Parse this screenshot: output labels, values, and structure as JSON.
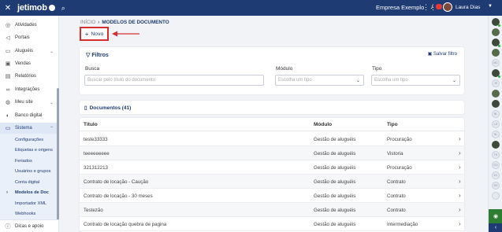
{
  "topbar": {
    "brand": "jetimob",
    "company": "Empresa Exemplo",
    "user": "Laura Dias"
  },
  "sidebar": {
    "items": [
      {
        "label": "Atividades",
        "icon": "check-circle-icon"
      },
      {
        "label": "Portais",
        "icon": "megaphone-icon"
      },
      {
        "label": "Aluguéis",
        "icon": "book-icon"
      },
      {
        "label": "Vendas",
        "icon": "cash-icon"
      },
      {
        "label": "Relatórios",
        "icon": "document-icon"
      },
      {
        "label": "Integrações",
        "icon": "link-icon"
      },
      {
        "label": "Meu site",
        "icon": "globe-icon"
      },
      {
        "label": "Banco digital",
        "icon": "piggy-bank-icon"
      },
      {
        "label": "Sistema",
        "icon": "monitor-icon"
      }
    ],
    "sub_items": [
      "Configurações",
      "Etiquetas e origens",
      "Feriados",
      "Usuários e grupos",
      "Conta digital",
      "Modelos de Doc",
      "Importador XML",
      "Webhooks"
    ],
    "bottom": "Dicas e apoio"
  },
  "breadcrumb": {
    "home": "INÍCIO",
    "current": "MODELOS DE DOCUMENTO"
  },
  "new_button": "Novo",
  "filters": {
    "title": "Filtros",
    "save": "Salvar filtro",
    "search_label": "Busca",
    "search_placeholder": "Buscar pelo título do documento",
    "module_label": "Módulo",
    "module_placeholder": "Escolha um tipo",
    "type_label": "Tipo",
    "type_placeholder": "Escolha um tipo"
  },
  "documents": {
    "title": "Documentos (41)",
    "columns": [
      "Título",
      "Módulo",
      "Tipo"
    ],
    "rows": [
      [
        "teste33333",
        "Gestão de aluguéis",
        "Procuração"
      ],
      [
        "teeeeeeeee",
        "Gestão de aluguéis",
        "Vistoria"
      ],
      [
        "321312213",
        "Gestão de aluguéis",
        "Procuração"
      ],
      [
        "Contrato de locação - Caução",
        "Gestão de aluguéis",
        "Contrato"
      ],
      [
        "Contrato de locação - 30 meses",
        "Gestão de aluguéis",
        "Contrato"
      ],
      [
        "Testezão",
        "Gestão de aluguéis",
        "Contrato"
      ],
      [
        "Contrato de locação quebra de pagina",
        "Gestão de aluguéis",
        "Intermediação"
      ]
    ]
  },
  "rail": {
    "initials": [
      "MC",
      "JE",
      "BL",
      "LG",
      "SL",
      "TK",
      "GO",
      "KC",
      "DS"
    ]
  },
  "colors": {
    "topbar": "#1f3b73",
    "highlight": "#d32f2f",
    "accent": "#1f3b73"
  }
}
